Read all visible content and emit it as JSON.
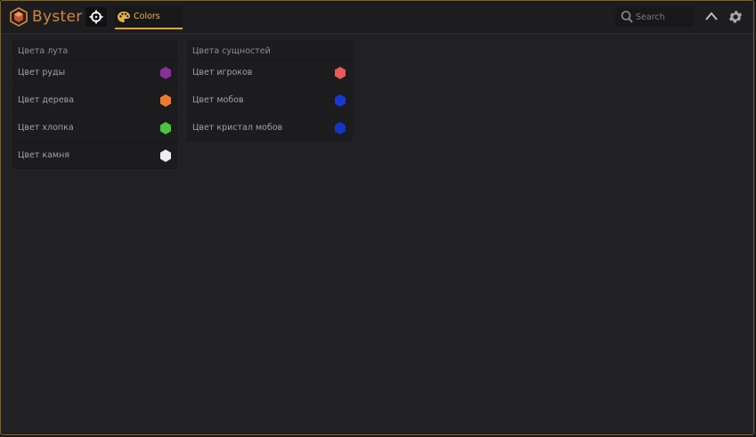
{
  "app": {
    "title": "Byster",
    "brand_color": "#d0883f",
    "accent": "#e6b24a"
  },
  "toolbar": {
    "tab_label": "Colors",
    "search_placeholder": "Search"
  },
  "panels": {
    "loot": {
      "title": "Цвета лута",
      "items": [
        {
          "label": "Цвет руды",
          "color": "#8a2f9a"
        },
        {
          "label": "Цвет дерева",
          "color": "#ee7a32"
        },
        {
          "label": "Цвет хлопка",
          "color": "#4dc441"
        },
        {
          "label": "Цвет камня",
          "color": "#eceef2"
        }
      ]
    },
    "entities": {
      "title": "Цвета сущностей",
      "items": [
        {
          "label": "Цвет игроков",
          "color": "#e75b5b"
        },
        {
          "label": "Цвет мобов",
          "color": "#1438d6"
        },
        {
          "label": "Цвет кристал мобов",
          "color": "#1434c8"
        }
      ]
    }
  }
}
